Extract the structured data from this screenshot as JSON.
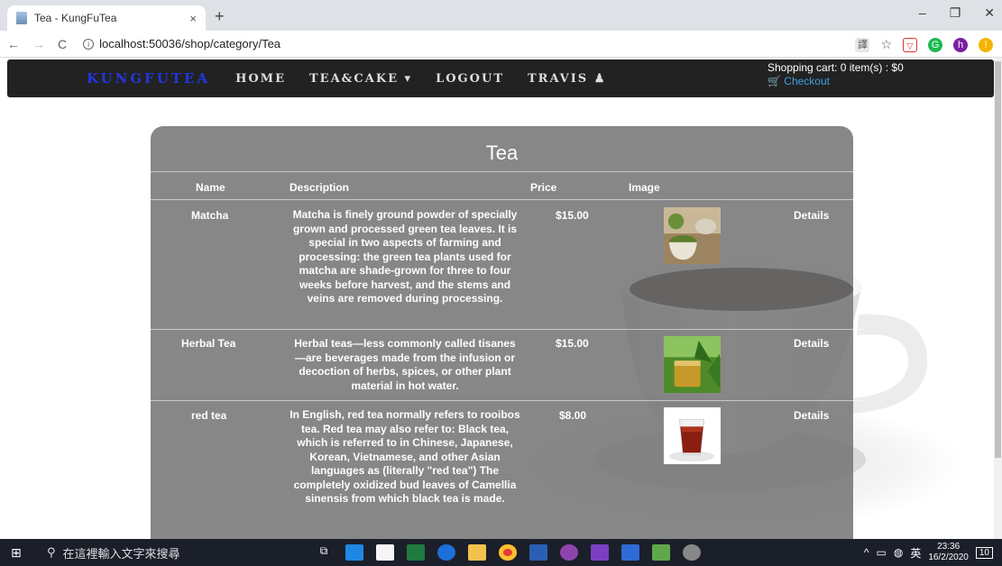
{
  "browser": {
    "tab_title": "Tea - KungFuTea",
    "tab_close": "×",
    "new_tab": "+",
    "url": "localhost:50036/shop/category/Tea",
    "win_min": "–",
    "win_max": "❐",
    "win_close": "✕"
  },
  "navbar": {
    "brand": "KUNGFUTEA",
    "links": [
      "HOME",
      "TEA&CAKE ▾",
      "LOGOUT",
      "TRAVIS"
    ],
    "cart_text": "Shopping cart: 0 item(s) : $0",
    "checkout": "Checkout"
  },
  "page": {
    "title": "Tea",
    "columns": [
      "Name",
      "Description",
      "Price",
      "Image"
    ],
    "products": [
      {
        "name": "Matcha",
        "description": "Matcha is finely ground powder of specially grown and processed green tea leaves. It is special in two aspects of farming and processing: the green tea plants used for matcha are shade-grown for three to four weeks before harvest, and the stems and veins are removed during processing.",
        "price": "$15.00",
        "details": "Details"
      },
      {
        "name": "Herbal Tea",
        "description": "Herbal teas—less commonly called tisanes —are beverages made from the infusion or decoction of herbs, spices, or other plant material in hot water.",
        "price": "$15.00",
        "details": "Details"
      },
      {
        "name": "red tea",
        "description": "In English, red tea normally refers to rooibos tea. Red tea may also refer to: Black tea, which is referred to in Chinese, Japanese, Korean, Vietnamese, and other Asian languages as (literally \"red tea\") The completely oxidized bud leaves of Camellia sinensis from which black tea is made.",
        "price": "$8.00",
        "details": "Details"
      }
    ]
  },
  "taskbar": {
    "search_placeholder": "在這裡輸入文字來搜尋",
    "ime": "英",
    "time": "23:36",
    "date": "16/2/2020",
    "notifications": "10"
  }
}
